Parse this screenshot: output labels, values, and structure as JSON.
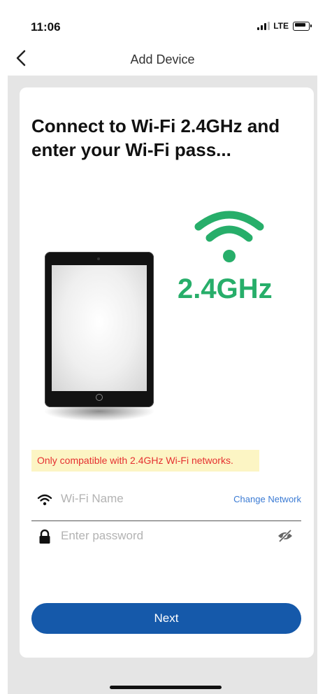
{
  "status_bar": {
    "time": "11:06",
    "network": "LTE"
  },
  "nav": {
    "title": "Add Device",
    "back_icon": "chevron-left-icon"
  },
  "heading": "Connect to Wi-Fi 2.4GHz and enter your Wi-Fi pass...",
  "illustration": {
    "band_label": "2.4GHz",
    "wifi_color": "#27ae6a"
  },
  "warning": {
    "text": "Only compatible with 2.4GHz Wi-Fi networks.",
    "text_color": "#e53030",
    "bg_color": "#fcf5c4"
  },
  "wifi_field": {
    "placeholder": "Wi-Fi Name",
    "value": "",
    "icon": "wifi-icon",
    "change_label": "Change Network"
  },
  "password_field": {
    "placeholder": "Enter password",
    "value": "",
    "icon": "lock-icon",
    "toggle_icon": "eye-off-icon"
  },
  "next_button": {
    "label": "Next",
    "color": "#1559aa"
  }
}
